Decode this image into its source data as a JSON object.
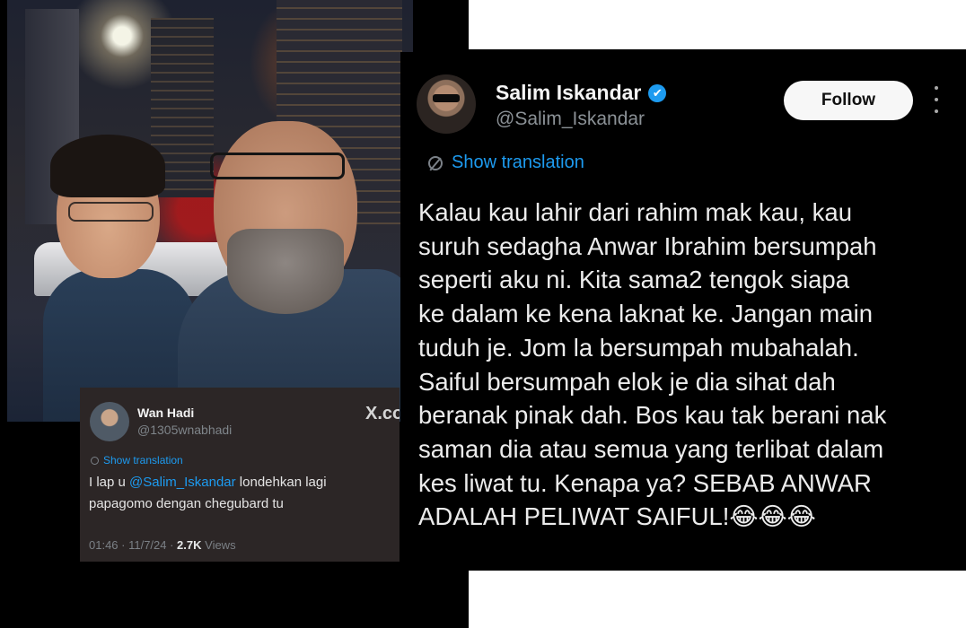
{
  "small_tweet": {
    "name": "Wan Hadi",
    "handle": "@1305wnabhadi",
    "logo_text": "X.com",
    "translate_label": "Show translation",
    "text_before": "I lap u ",
    "mention": "@Salim_Iskandar",
    "text_after": " londehkan lagi papagomo dengan chegubard tu",
    "timestamp": "01:46 · 11/7/24 · ",
    "views_count": "2.7K",
    "views_label": " Views"
  },
  "main_tweet": {
    "name": "Salim Iskandar",
    "verified": "✔",
    "handle": "@Salim_Iskandar",
    "follow_label": "Follow",
    "translate_label": "Show translation",
    "lines": [
      "Kalau kau lahir dari rahim mak kau, kau",
      "suruh sedagha Anwar Ibrahim bersumpah",
      "seperti aku ni. Kita sama2 tengok siapa",
      "ke dalam ke kena laknat ke. Jangan main",
      "tuduh je. Jom la bersumpah mubahalah.",
      "Saiful bersumpah elok je dia sihat dah",
      "beranak pinak dah. Bos kau tak berani nak",
      "saman dia atau semua yang terlibat dalam",
      "kes liwat tu. Kenapa ya? SEBAB ANWAR",
      "ADALAH PELIWAT SAIFUL!😂😂😂"
    ]
  },
  "colors": {
    "accent": "#1d9bf0",
    "background": "#000000",
    "card": "#2c2626"
  }
}
